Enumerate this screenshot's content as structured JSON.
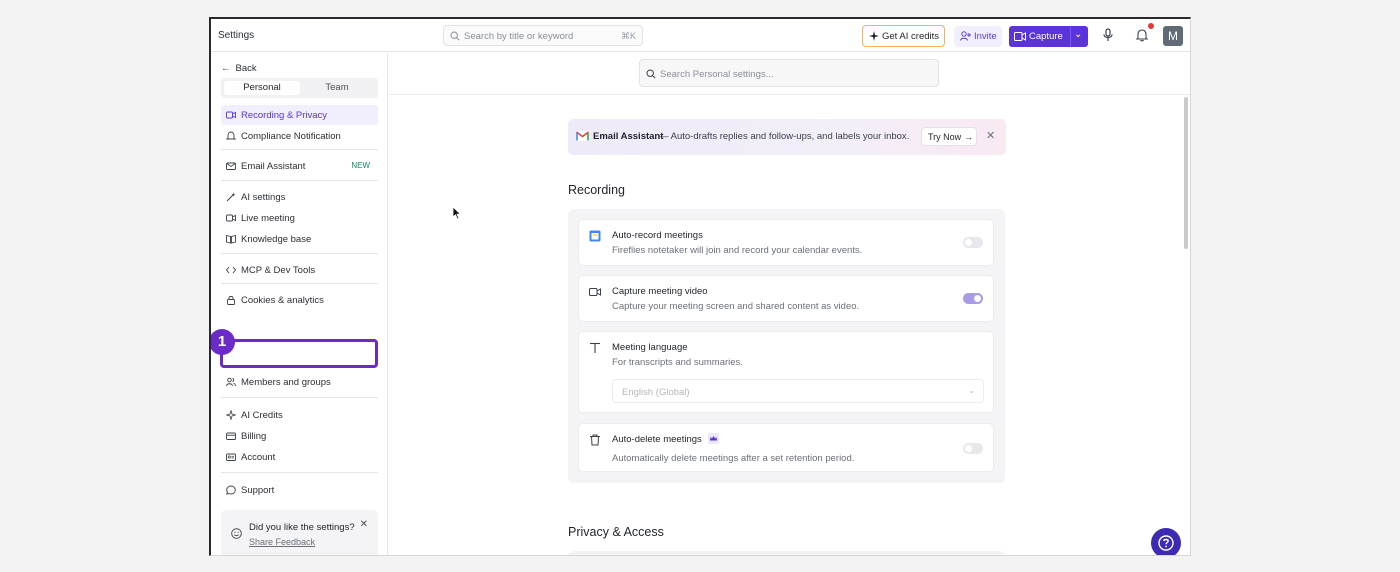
{
  "window": {
    "title": "Settings"
  },
  "topbar": {
    "search_placeholder": "Search by title or keyword",
    "search_shortcut": "⌘K",
    "ai_credits_label": "Get AI credits",
    "invite_label": "Invite",
    "capture_label": "Capture",
    "avatar_initial": "M"
  },
  "sidebar": {
    "back_label": "Back",
    "tabs": [
      {
        "label": "Personal",
        "active": true
      },
      {
        "label": "Team",
        "active": false
      }
    ],
    "items": [
      {
        "label": "Recording & Privacy",
        "icon": "video-icon",
        "active": true
      },
      {
        "label": "Compliance Notification",
        "icon": "bell-icon"
      },
      {
        "label": "Email Assistant",
        "icon": "mail-icon",
        "badge": "NEW"
      },
      {
        "label": "AI settings",
        "icon": "magic-wand-icon"
      },
      {
        "label": "Live meeting",
        "icon": "live-icon"
      },
      {
        "label": "Knowledge base",
        "icon": "book-icon"
      },
      {
        "label": "MCP & Dev Tools",
        "icon": "code-icon"
      },
      {
        "label": "Cookies & analytics",
        "icon": "lock-icon"
      },
      {
        "label": "Members and groups",
        "icon": "users-icon"
      },
      {
        "label": "AI Credits",
        "icon": "sparkle-icon"
      },
      {
        "label": "Billing",
        "icon": "card-icon"
      },
      {
        "label": "Account",
        "icon": "id-card-icon"
      },
      {
        "label": "Support",
        "icon": "chat-icon"
      }
    ],
    "marker_number": "1",
    "feedback": {
      "question": "Did you like the settings?",
      "link": "Share Feedback"
    }
  },
  "main": {
    "search_placeholder": "Search Personal settings...",
    "banner": {
      "title": "Email Assistant",
      "text": "— Auto-drafts replies and follow-ups, and labels your inbox.",
      "cta": "Try Now"
    },
    "recording_section": {
      "title": "Recording",
      "cards": [
        {
          "title": "Auto-record meetings",
          "description": "Fireflies notetaker will join and record your calendar events.",
          "toggle_on": false
        },
        {
          "title": "Capture meeting video",
          "description": "Capture your meeting screen and shared content as video.",
          "toggle_on": true
        },
        {
          "title": "Meeting language",
          "description": "For transcripts and summaries.",
          "select_value": "English (Global)"
        },
        {
          "title": "Auto-delete meetings",
          "description": "Automatically delete meetings after a set retention period.",
          "toggle_on": false
        }
      ]
    },
    "privacy_section": {
      "title": "Privacy & Access"
    }
  },
  "colors": {
    "accent": "#5a34d9",
    "marker": "#6a2bc9",
    "toggle_on": "#a99be6",
    "ai_border": "#f2b15d"
  }
}
